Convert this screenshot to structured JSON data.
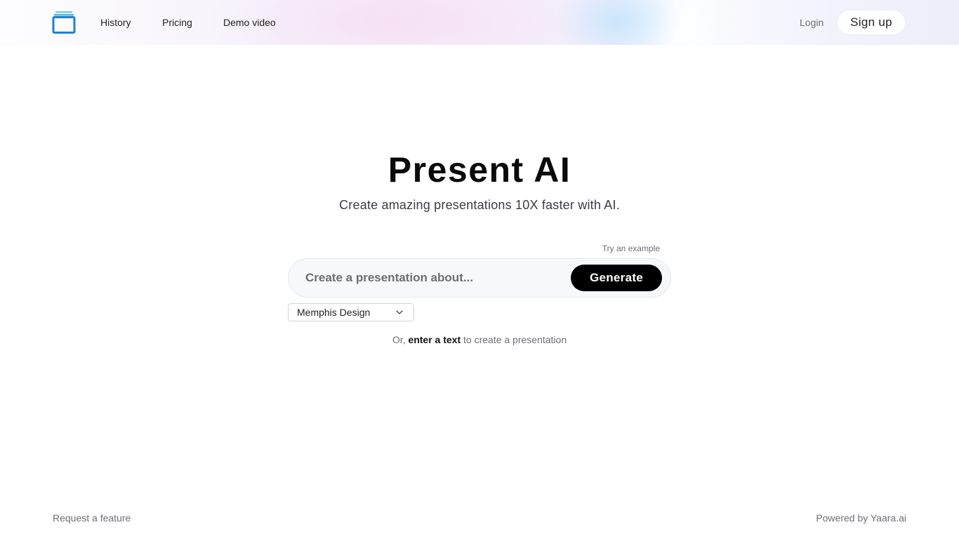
{
  "header": {
    "logo": "stacked-slides-logo",
    "nav": [
      {
        "label": "History"
      },
      {
        "label": "Pricing"
      },
      {
        "label": "Demo video"
      }
    ],
    "login_label": "Login",
    "signup_label": "Sign up"
  },
  "hero": {
    "title": "Present AI",
    "subtitle": "Create amazing presentations 10X faster with AI."
  },
  "prompt": {
    "try_example_label": "Try an example",
    "placeholder": "Create a presentation about...",
    "value": "",
    "generate_label": "Generate"
  },
  "theme": {
    "selected": "Memphis Design",
    "icon": "chevron-down-icon"
  },
  "alternative": {
    "prefix": "Or, ",
    "link": "enter a text",
    "suffix": " to create a presentation"
  },
  "footer": {
    "left_link": "Request a feature",
    "right_text": "Powered by Yaara.ai"
  },
  "colors": {
    "logo_blue": "#1f82cf",
    "logo_light": "#5bb8e0",
    "button_dark": "#000000"
  }
}
